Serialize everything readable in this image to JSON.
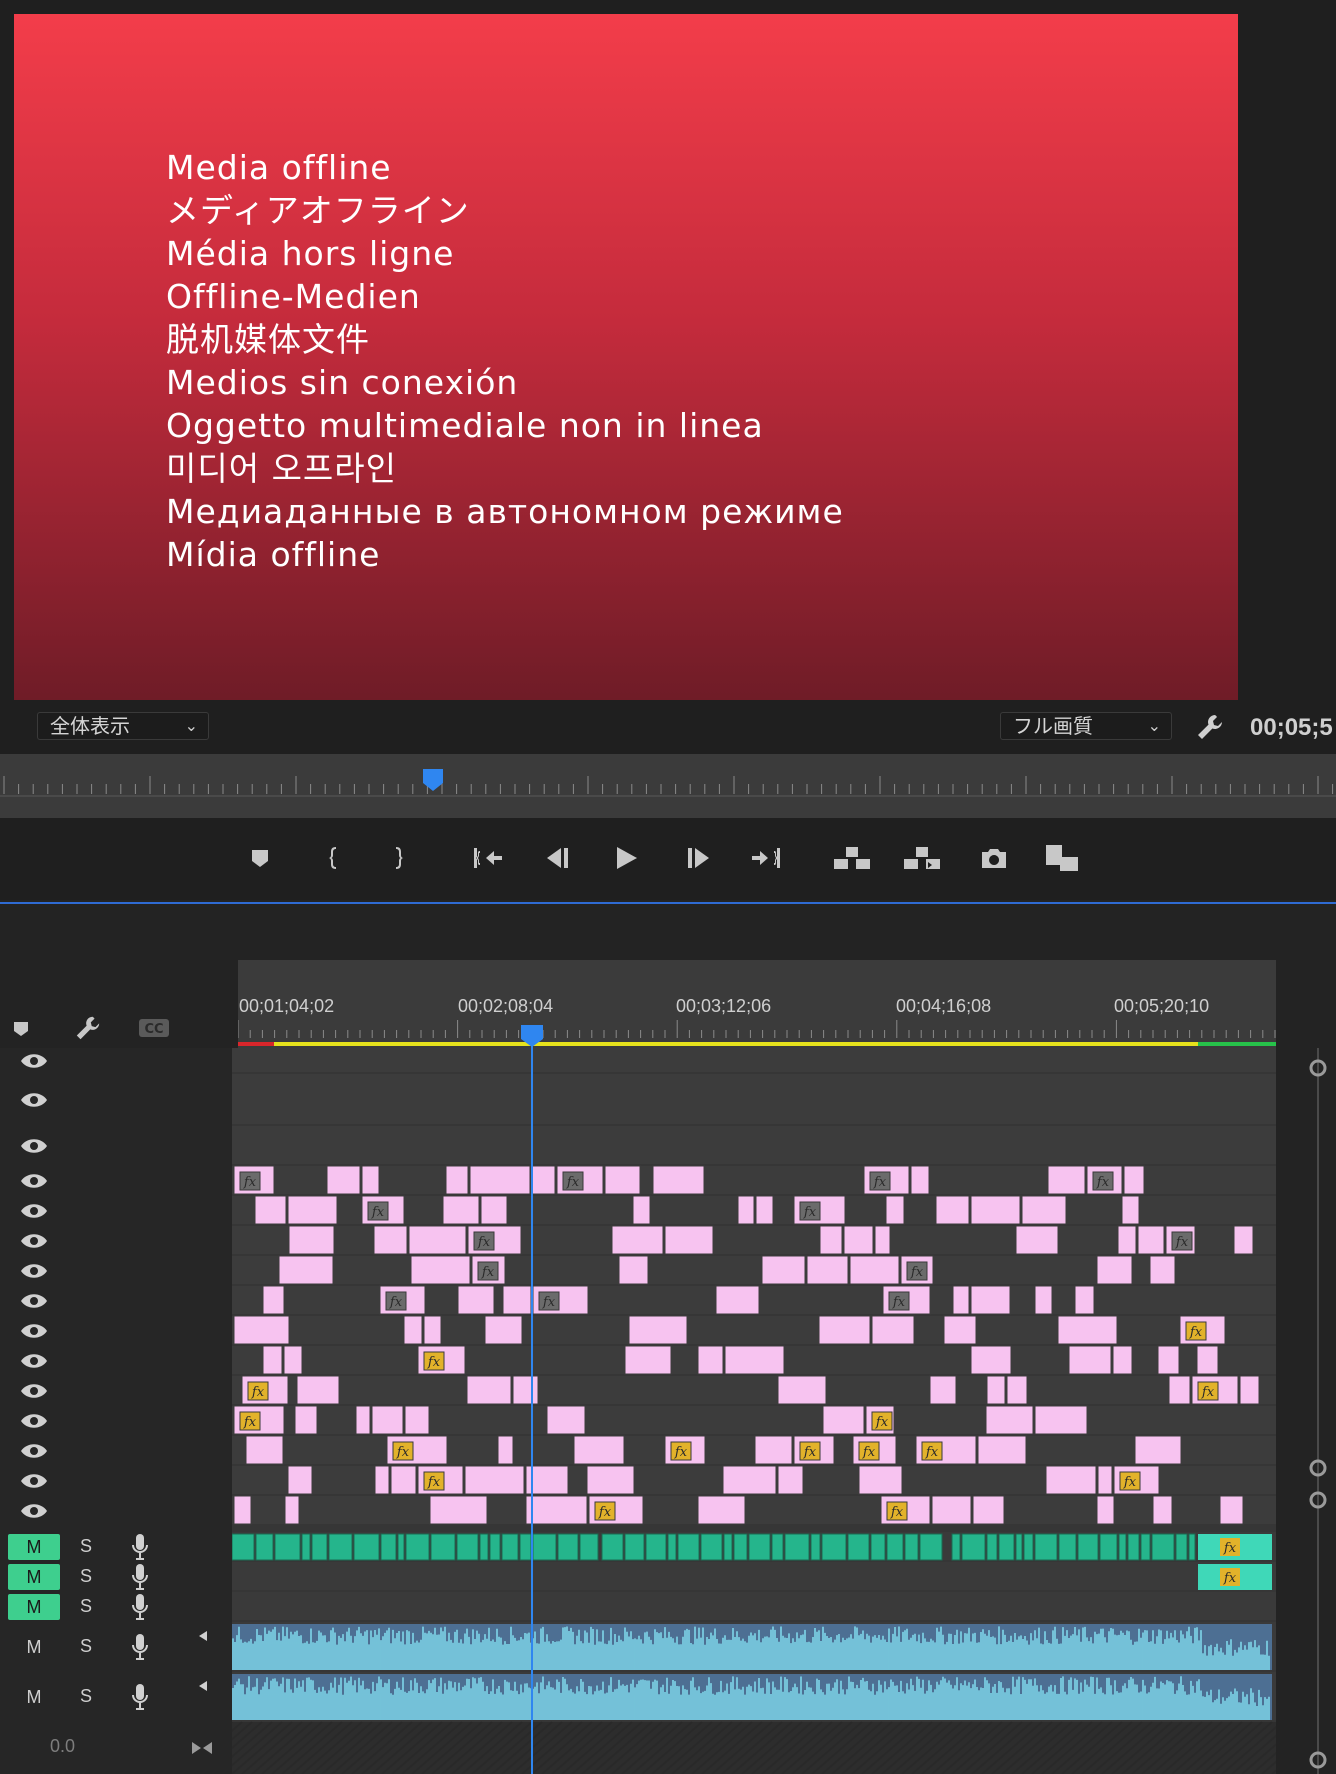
{
  "monitor": {
    "offline_lines": [
      "Media offline",
      "メディアオフライン",
      "Média hors ligne",
      "Offline-Medien",
      "脱机媒体文件",
      "Medios sin conexión",
      "Oggetto multimediale non in linea",
      "미디어 오프라인",
      "Медиаданные в автономном режиме",
      "Mídia offline"
    ],
    "zoom_label": "全体表示",
    "quality_label": "フル画質",
    "timecode": "00;05;5"
  },
  "transport": {
    "buttons": [
      "add-marker",
      "mark-in",
      "mark-out",
      "go-to-in",
      "step-back",
      "play",
      "step-forward",
      "go-to-out",
      "lift",
      "extract",
      "export-frame",
      "button-editor"
    ]
  },
  "timeline": {
    "timecodes": [
      "00;01;04;02",
      "00;02;08;04",
      "00;03;12;06",
      "00;04;16;08",
      "00;05;20;10"
    ],
    "audio_tracks": [
      {
        "m": "M",
        "s": "S",
        "m_active": true
      },
      {
        "m": "M",
        "s": "S",
        "m_active": true
      },
      {
        "m": "M",
        "s": "S",
        "m_active": true
      },
      {
        "m": "M",
        "s": "S",
        "m_active": false
      },
      {
        "m": "M",
        "s": "S",
        "m_active": false
      }
    ],
    "volume": "0.0",
    "fx_label": "fx",
    "colors": {
      "video_clip": "#f7c3f0",
      "audio_clip": "#7fd6e9",
      "audio_nested": "#25b58c",
      "playhead": "#2f86f0",
      "work_area_yellow": "#e6e21c",
      "work_area_red": "#d9262b",
      "work_area_green": "#27c24a"
    }
  }
}
